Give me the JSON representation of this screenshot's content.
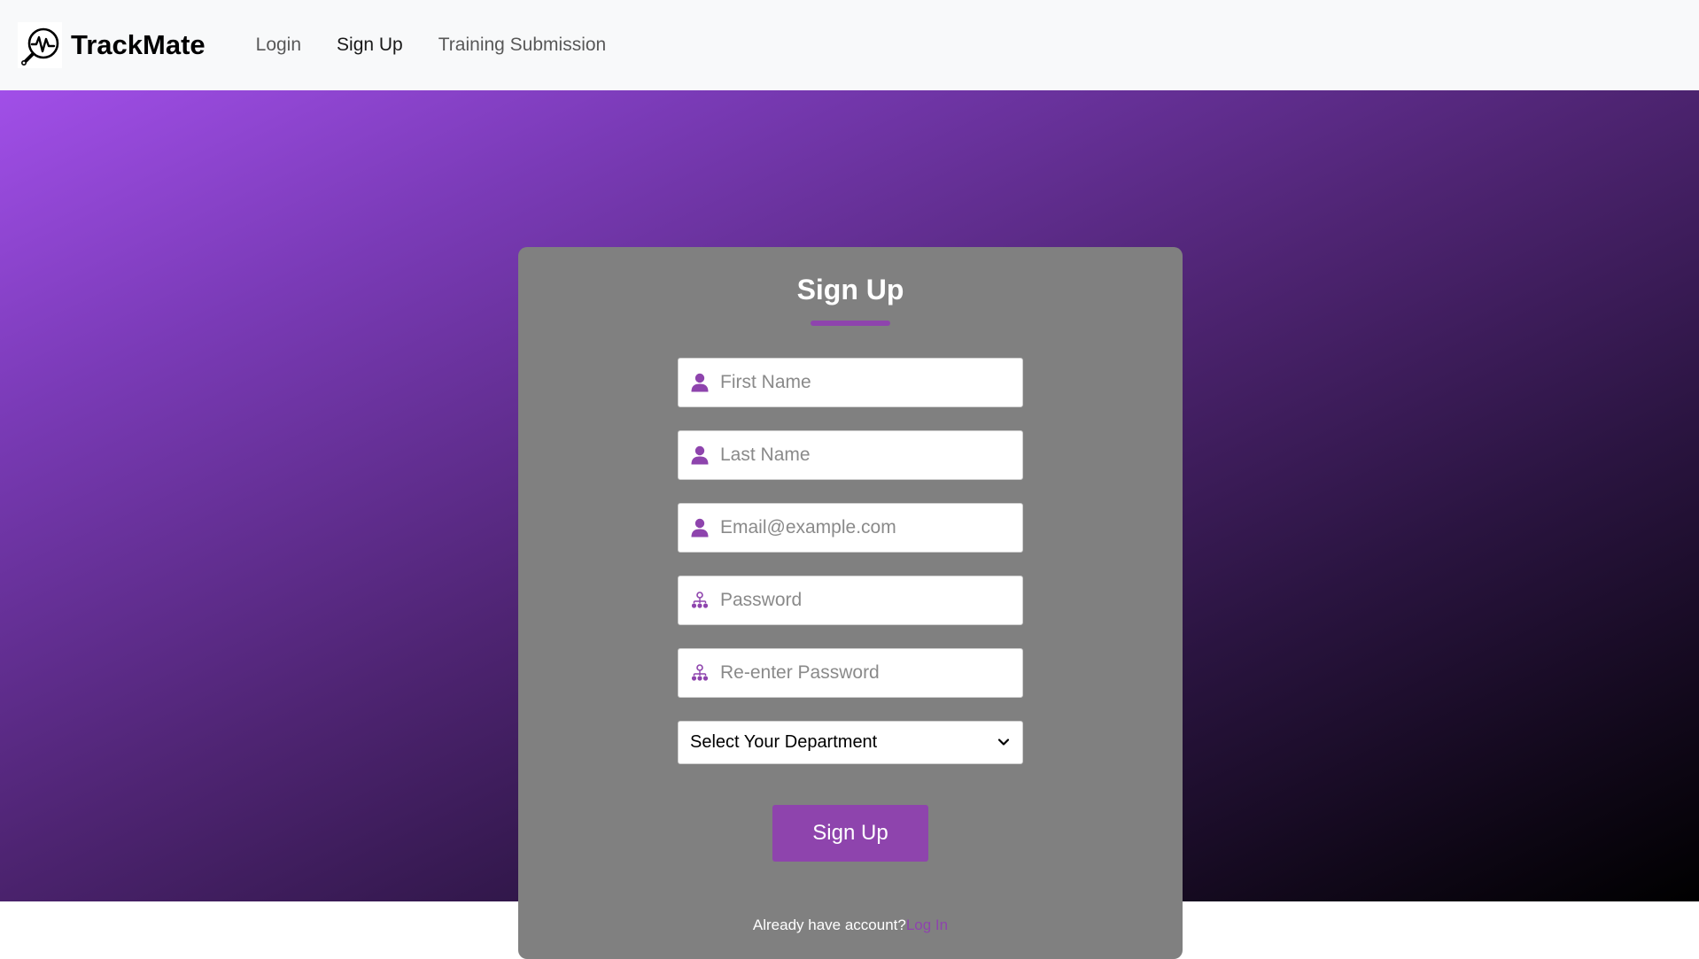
{
  "brand": {
    "name": "TrackMate",
    "logo_icon": "heartbeat-magnifier-icon"
  },
  "nav": {
    "items": [
      {
        "label": "Login",
        "active": false
      },
      {
        "label": "Sign Up",
        "active": true
      },
      {
        "label": "Training Submission",
        "active": false
      }
    ]
  },
  "form": {
    "title": "Sign Up",
    "fields": [
      {
        "placeholder": "First Name",
        "value": "",
        "icon": "user-icon"
      },
      {
        "placeholder": "Last Name",
        "value": "",
        "icon": "user-icon"
      },
      {
        "placeholder": "Email@example.com",
        "value": "",
        "icon": "user-icon"
      },
      {
        "placeholder": "Password",
        "value": "",
        "icon": "users-hierarchy-icon"
      },
      {
        "placeholder": "Re-enter Password",
        "value": "",
        "icon": "users-hierarchy-icon"
      }
    ],
    "department_select": {
      "selected": "Select Your Department",
      "icon": "chevron-down-icon"
    },
    "submit_label": "Sign Up",
    "footer_text": "Already have account?",
    "footer_link": "Log In"
  },
  "colors": {
    "accent": "#8e44ad",
    "card": "#808080",
    "navbar": "#f8f9fa"
  }
}
